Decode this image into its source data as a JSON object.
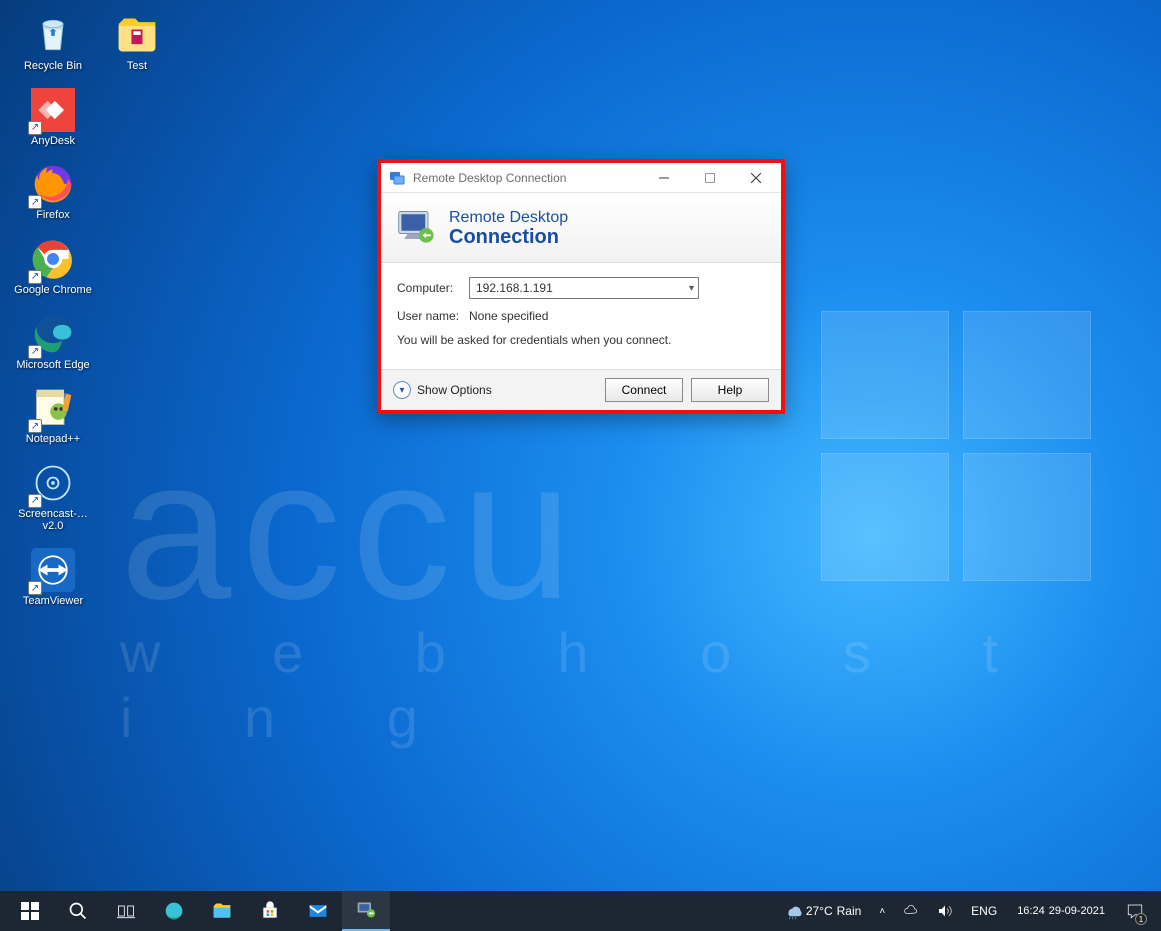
{
  "desktop": {
    "icons": [
      {
        "key": "recycle",
        "label": "Recycle Bin",
        "shortcut": false
      },
      {
        "key": "anydesk",
        "label": "AnyDesk",
        "shortcut": true
      },
      {
        "key": "firefox",
        "label": "Firefox",
        "shortcut": true
      },
      {
        "key": "chrome",
        "label": "Google Chrome",
        "shortcut": true
      },
      {
        "key": "edge",
        "label": "Microsoft Edge",
        "shortcut": true
      },
      {
        "key": "notepadpp",
        "label": "Notepad++",
        "shortcut": true
      },
      {
        "key": "screencast",
        "label": "Screencast-… v2.0",
        "shortcut": true
      },
      {
        "key": "teamviewer",
        "label": "TeamViewer",
        "shortcut": true
      }
    ],
    "icon_test": {
      "label": "Test",
      "shortcut": false
    },
    "watermark_line1": "accu",
    "watermark_line2": "w e b   h o s t i n g"
  },
  "dialog": {
    "title": "Remote Desktop Connection",
    "banner_line1": "Remote Desktop",
    "banner_line2": "Connection",
    "computer_label": "Computer:",
    "computer_value": "192.168.1.191",
    "username_label": "User name:",
    "username_value": "None specified",
    "hint": "You will be asked for credentials when you connect.",
    "show_options": "Show Options",
    "connect": "Connect",
    "help": "Help"
  },
  "taskbar": {
    "weather_temp": "27°C",
    "weather_desc": "Rain",
    "lang": "ENG",
    "time": "16:24",
    "date": "29-09-2021",
    "notif_count": "1"
  },
  "colors": {
    "highlight": "#ee1111",
    "accent": "#0078d7"
  }
}
